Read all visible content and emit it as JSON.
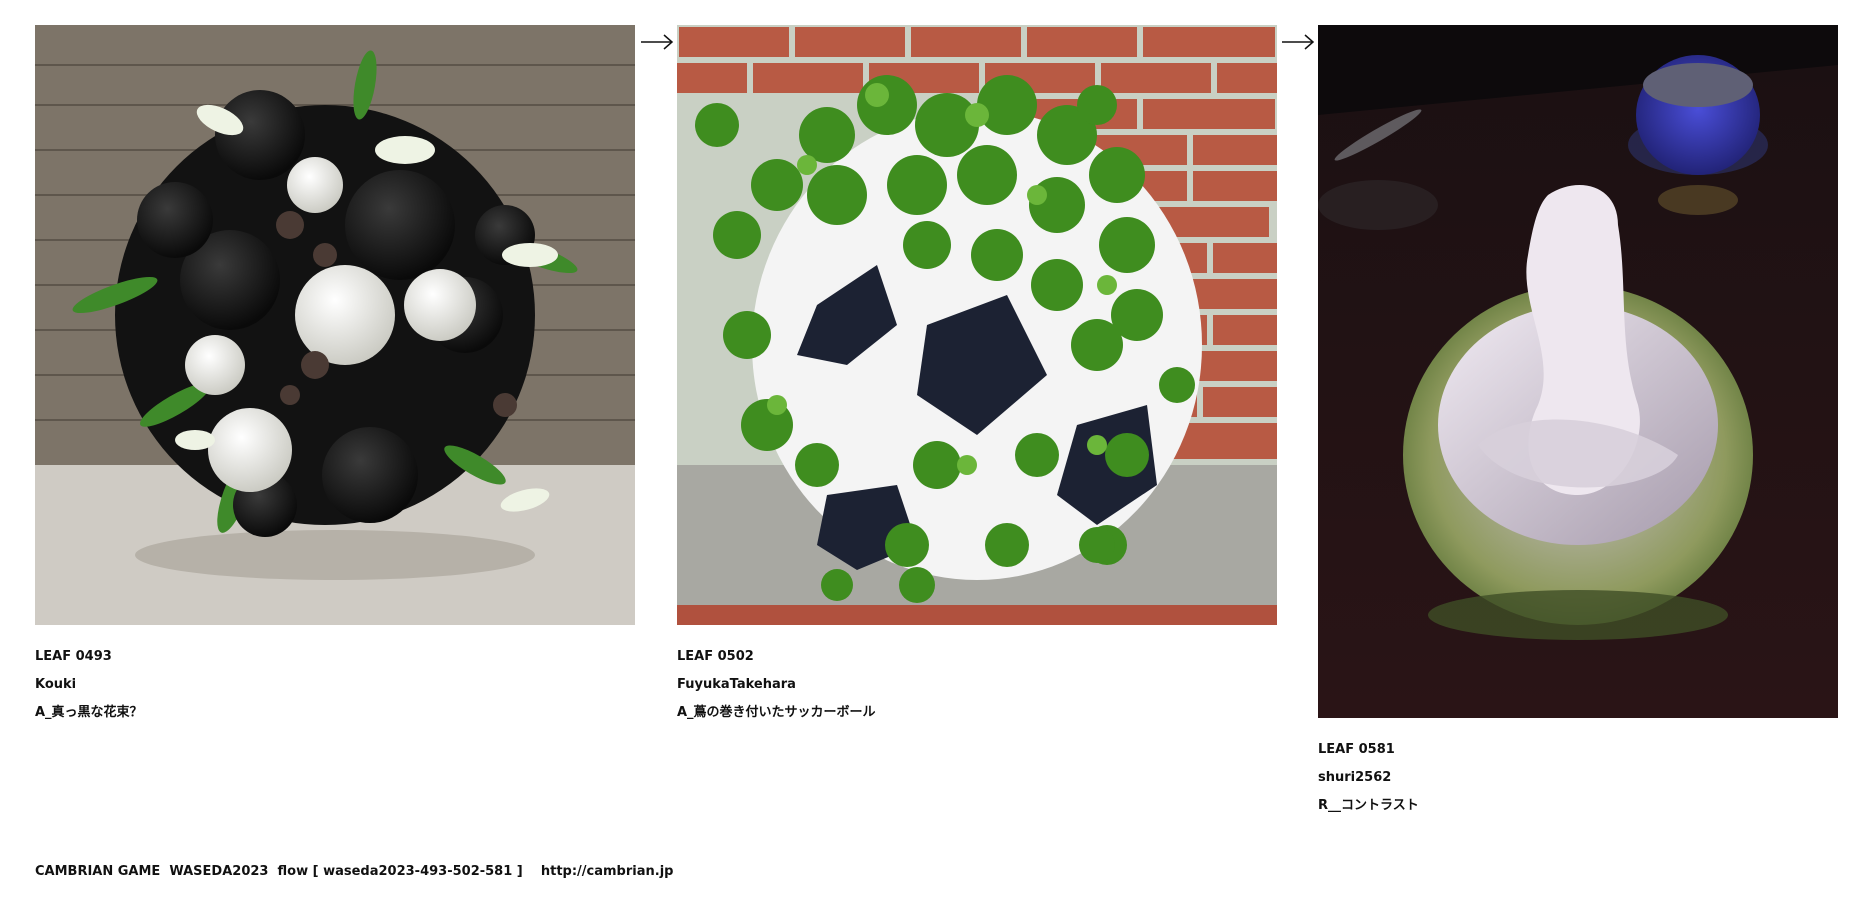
{
  "leaves": [
    {
      "id": "LEAF 0493",
      "author": "Kouki",
      "title": "A_真っ黒な花束？",
      "image": "black-and-white-rose-bouquet"
    },
    {
      "id": "LEAF 0502",
      "author": "FuyukaTakehara",
      "title": "A_蔦の巻き付いたサッカーボール",
      "image": "ivy-covered-soccer-ball"
    },
    {
      "id": "LEAF 0581",
      "author": "shuri2562",
      "title": "R__コントラスト",
      "image": "blurry-soft-serve-ice-cream"
    }
  ],
  "footer": {
    "text": "CAMBRIAN GAME  WASEDA2023  flow [ waseda2023-493-502-581 ]    ",
    "link": "http://cambrian.jp"
  },
  "icons": {
    "arrow": "right-arrow-icon"
  }
}
